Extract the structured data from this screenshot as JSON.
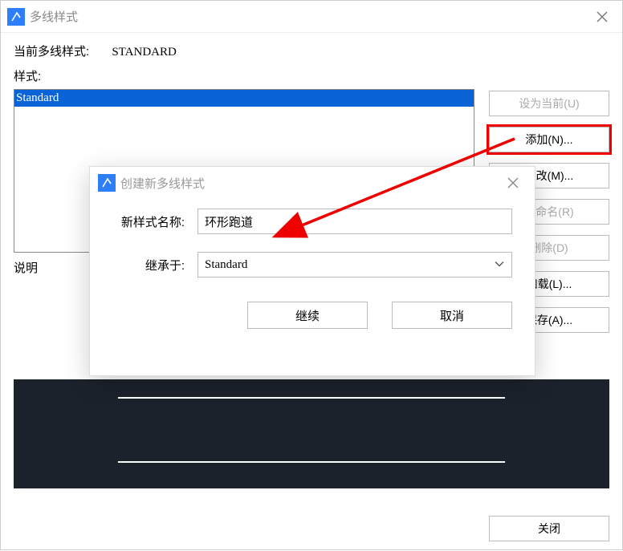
{
  "main": {
    "title": "多线样式",
    "currentLabel": "当前多线样式:",
    "currentValue": "STANDARD",
    "stylesLabel": "样式:",
    "list": {
      "selected": "Standard"
    },
    "descLabel": "说明",
    "buttons": {
      "setCurrent": "设为当前(U)",
      "add": "添加(N)...",
      "modify": "修改(M)...",
      "rename": "重命名(R)",
      "delete": "删除(D)",
      "load": "加载(L)...",
      "save": "保存(A)...",
      "close": "关闭"
    }
  },
  "inner": {
    "title": "创建新多线样式",
    "nameLabel": "新样式名称:",
    "nameValue": "环形跑道",
    "inheritLabel": "继承于:",
    "inheritValue": "Standard",
    "continue": "继续",
    "cancel": "取消"
  }
}
